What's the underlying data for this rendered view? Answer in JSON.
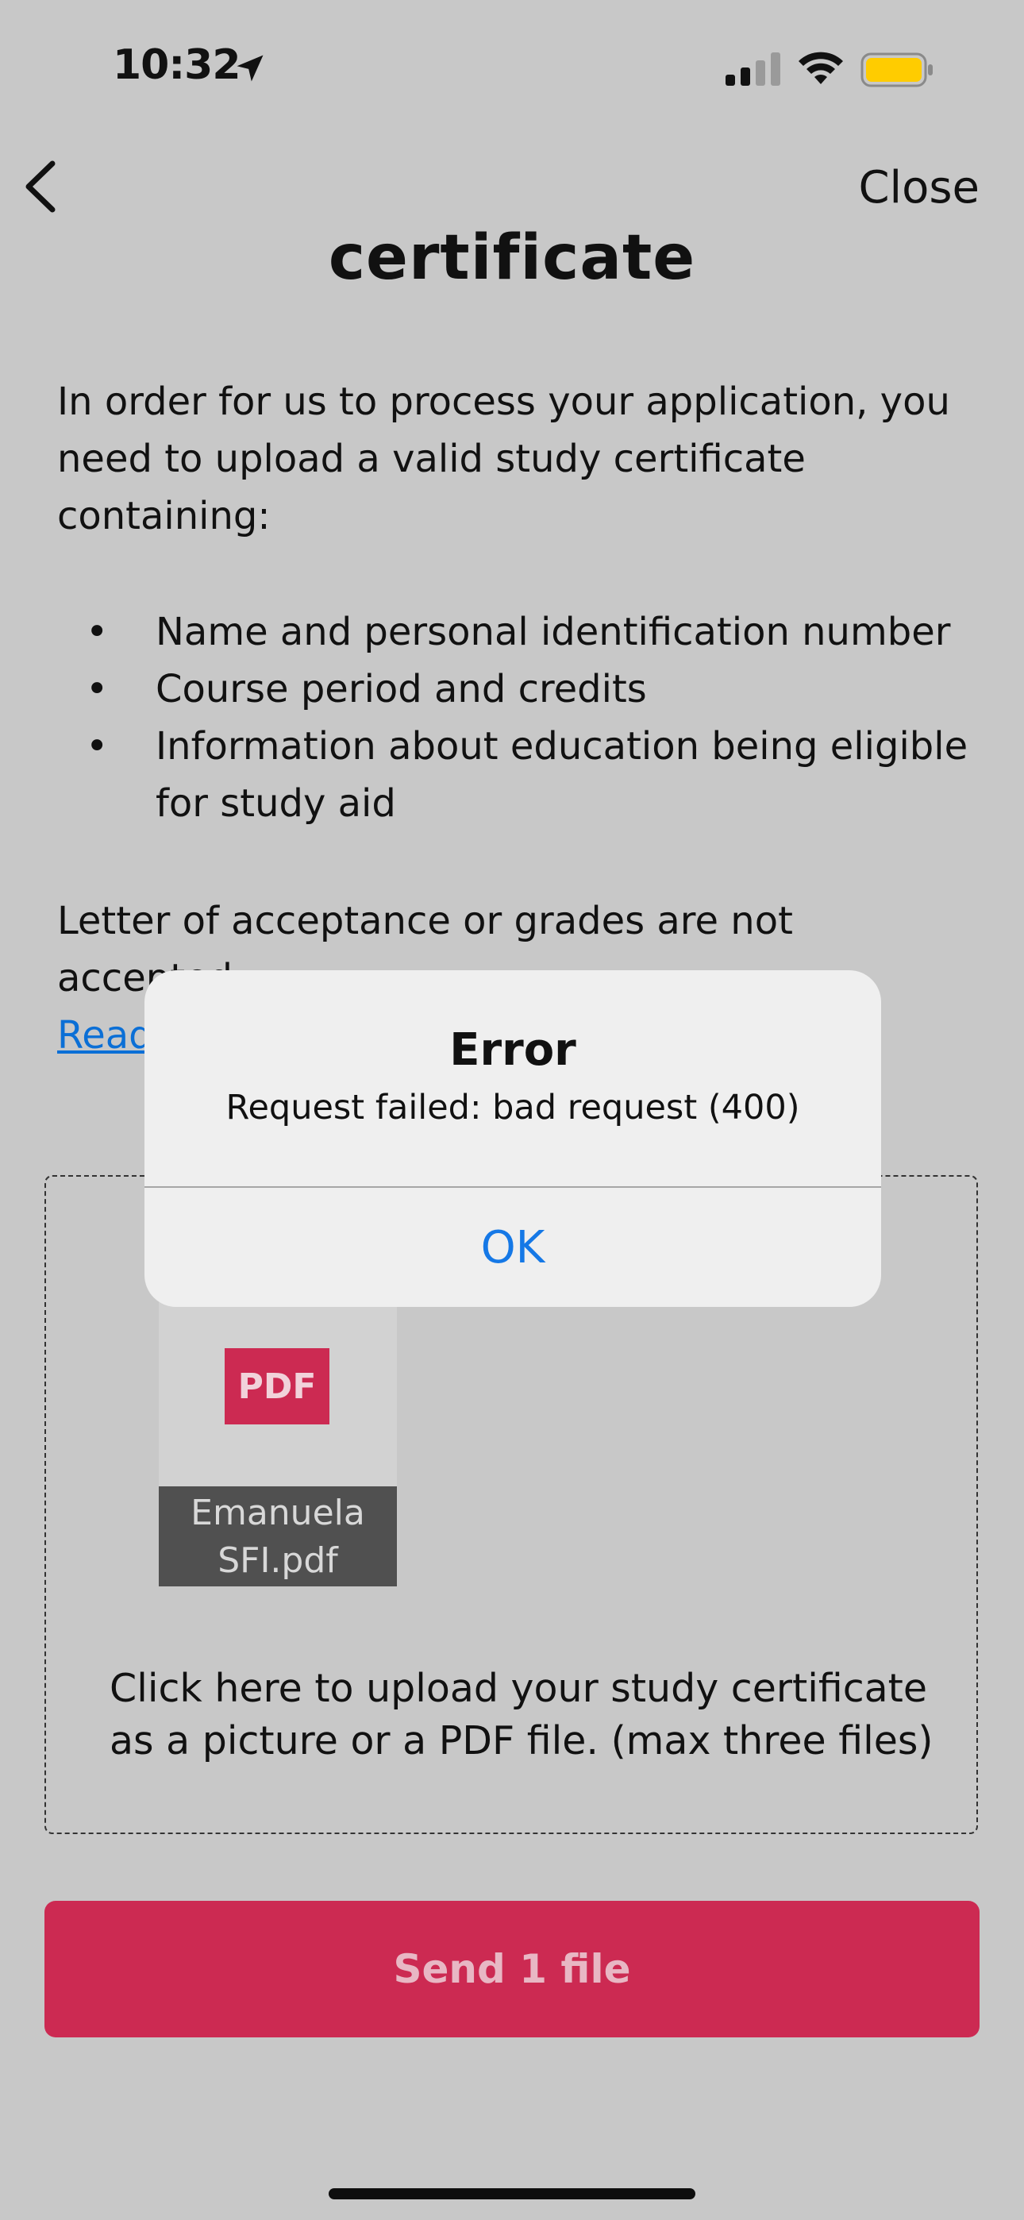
{
  "status_bar": {
    "time": "10:32"
  },
  "nav": {
    "close_label": "Close"
  },
  "page": {
    "title": "certificate",
    "intro": "In order for us to process your application, you need to upload a valid study certificate containing:",
    "requirements": [
      "Name and personal identification number",
      "Course period and credits",
      "Information about education being eligible for study aid"
    ],
    "bullet_char": "•",
    "notice": "Letter of acceptance or grades are not accepted.",
    "read_more": "Read"
  },
  "upload": {
    "files": [
      {
        "type_badge": "PDF",
        "name_line1": "Emanuela",
        "name_line2": "SFI.pdf"
      }
    ],
    "hint": "Click here to upload your study certificate as a picture or a PDF file. (max three files)"
  },
  "send_button": {
    "label": "Send 1 file"
  },
  "alert": {
    "title": "Error",
    "message": "Request failed: bad request (400)",
    "ok_label": "OK"
  },
  "colors": {
    "background": "#c8c8c8",
    "accent": "#cc2a52",
    "link": "#0b6fd6",
    "alert_button": "#1578e6",
    "battery": "#ffcc00"
  }
}
